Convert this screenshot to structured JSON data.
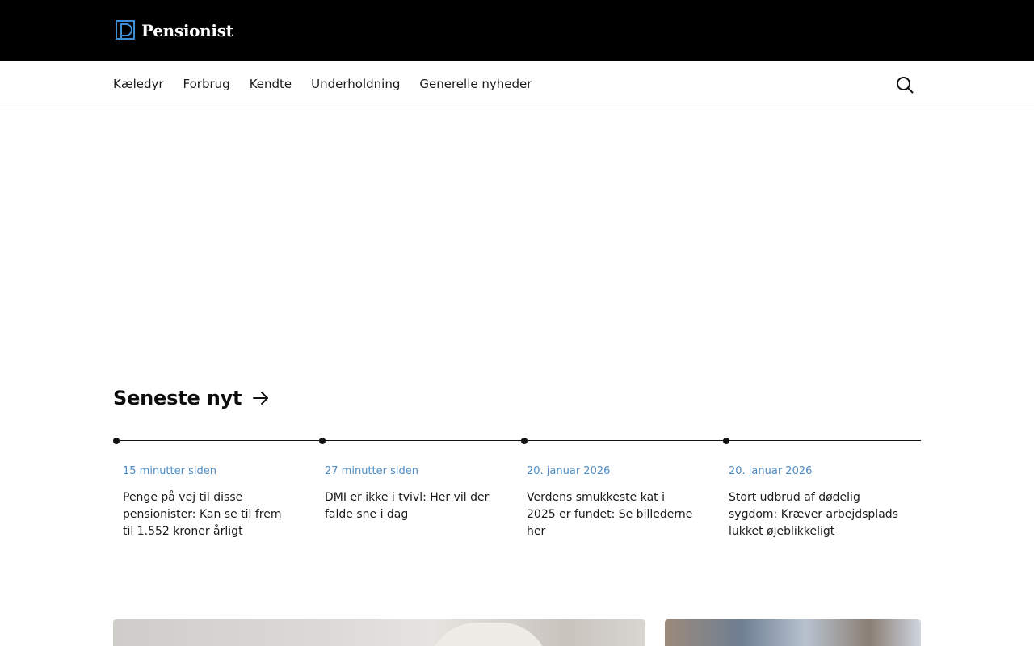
{
  "brand": {
    "name": "Pensionist"
  },
  "nav": {
    "items": [
      "Kæledyr",
      "Forbrug",
      "Kendte",
      "Underholdning",
      "Generelle nyheder"
    ]
  },
  "latest": {
    "title": "Seneste nyt",
    "items": [
      {
        "time": "15 minutter siden",
        "title": "Penge på vej til disse pensionister: Kan se til frem til 1.552 kroner årligt"
      },
      {
        "time": "27 minutter siden",
        "title": "DMI er ikke i tvivl: Her vil der falde sne i dag"
      },
      {
        "time": "20. januar 2026",
        "title": "Verdens smukkeste kat i 2025 er fundet: Se billederne her"
      },
      {
        "time": "20. januar 2026",
        "title": "Stort udbrud af dødelig sygdom: Kræver arbejdsplads lukket øjeblikkeligt"
      }
    ]
  },
  "colors": {
    "header_bg": "#000000",
    "accent": "#4d8cc4",
    "logo_mark": "#3b8fd6"
  },
  "icons": {
    "search": "search-icon",
    "arrow": "arrow-right-icon",
    "logo": "logo-mark-icon"
  }
}
